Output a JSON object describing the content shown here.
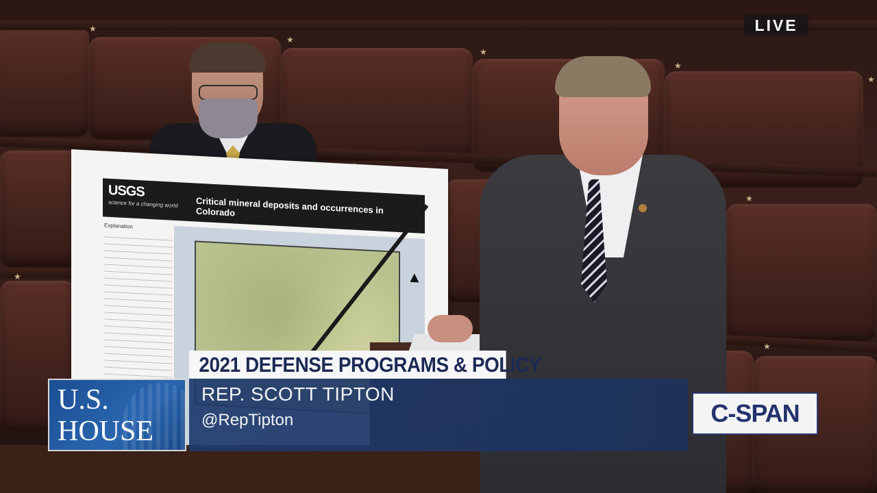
{
  "overlay": {
    "live_label": "LIVE",
    "house_line1": "U.S.",
    "house_line2": "HOUSE",
    "topic": "2021 DEFENSE PROGRAMS & POLICY",
    "speaker_name": "REP. SCOTT TIPTON",
    "speaker_handle": "@RepTipton",
    "network_logo": "C-SPAN"
  },
  "map_board": {
    "agency_logo": "USGS",
    "agency_tagline": "science for a changing world",
    "title": "Critical mineral deposits and occurrences in Colorado",
    "legend_heading": "Explanation"
  },
  "colors": {
    "overlay_blue": "#1e3a6e",
    "topic_text": "#1b2a55",
    "bar_white": "#f6f6f8",
    "chamber_leather": "#4a2620"
  },
  "icons": {
    "north_arrow": "north-arrow-icon",
    "star_ornament": "star-icon"
  }
}
